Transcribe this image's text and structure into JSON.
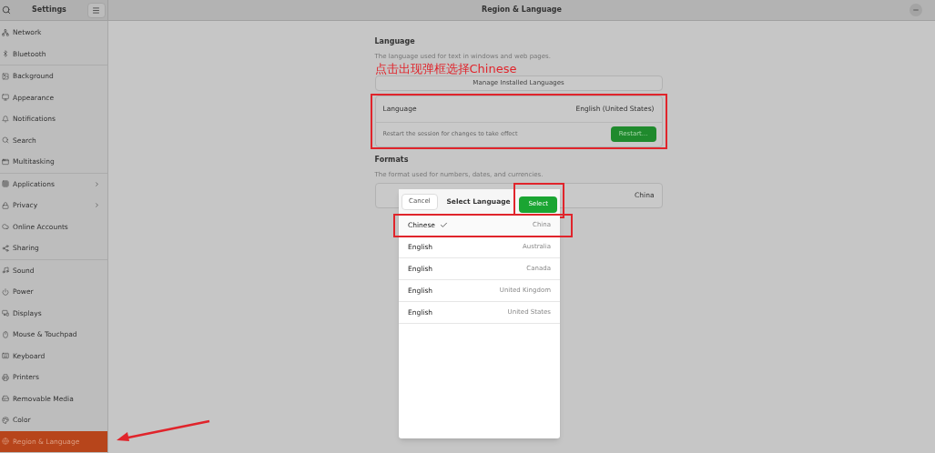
{
  "window": {
    "title": "Settings",
    "page_title": "Region & Language"
  },
  "sidebar": {
    "groups": [
      [
        {
          "label": "Network",
          "selected": false,
          "submenu": false
        },
        {
          "label": "Bluetooth",
          "selected": false,
          "submenu": false
        }
      ],
      [
        {
          "label": "Background",
          "selected": false,
          "submenu": false
        },
        {
          "label": "Appearance",
          "selected": false,
          "submenu": false
        },
        {
          "label": "Notifications",
          "selected": false,
          "submenu": false
        },
        {
          "label": "Search",
          "selected": false,
          "submenu": false
        },
        {
          "label": "Multitasking",
          "selected": false,
          "submenu": false
        }
      ],
      [
        {
          "label": "Applications",
          "selected": false,
          "submenu": true
        },
        {
          "label": "Privacy",
          "selected": false,
          "submenu": true
        },
        {
          "label": "Online Accounts",
          "selected": false,
          "submenu": false
        },
        {
          "label": "Sharing",
          "selected": false,
          "submenu": false
        }
      ],
      [
        {
          "label": "Sound",
          "selected": false,
          "submenu": false
        },
        {
          "label": "Power",
          "selected": false,
          "submenu": false
        },
        {
          "label": "Displays",
          "selected": false,
          "submenu": false
        },
        {
          "label": "Mouse & Touchpad",
          "selected": false,
          "submenu": false
        },
        {
          "label": "Keyboard",
          "selected": false,
          "submenu": false
        },
        {
          "label": "Printers",
          "selected": false,
          "submenu": false
        },
        {
          "label": "Removable Media",
          "selected": false,
          "submenu": false
        },
        {
          "label": "Color",
          "selected": false,
          "submenu": false
        },
        {
          "label": "Region & Language",
          "selected": true,
          "submenu": false
        }
      ]
    ]
  },
  "language_section": {
    "heading": "Language",
    "description": "The language used for text in windows and web pages.",
    "manage_button": "Manage Installed Languages",
    "language_row": {
      "label": "Language",
      "value": "English (United States)"
    },
    "restart_row": {
      "text": "Restart the session for changes to take effect",
      "button": "Restart..."
    }
  },
  "formats_section": {
    "heading": "Formats",
    "description": "The format used for numbers, dates, and currencies.",
    "row": {
      "value": "China"
    }
  },
  "dialog": {
    "cancel": "Cancel",
    "title": "Select Language",
    "select": "Select",
    "options": [
      {
        "language": "Chinese",
        "region": "China",
        "selected": true
      },
      {
        "language": "English",
        "region": "Australia",
        "selected": false
      },
      {
        "language": "English",
        "region": "Canada",
        "selected": false
      },
      {
        "language": "English",
        "region": "United Kingdom",
        "selected": false
      },
      {
        "language": "English",
        "region": "United States",
        "selected": false
      }
    ]
  },
  "annotation": {
    "text": "点击出现弹框选择Chinese"
  }
}
